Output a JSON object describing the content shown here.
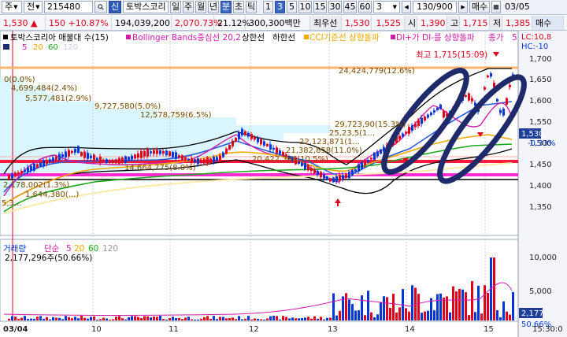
{
  "toolbar": {
    "type_select": "주",
    "market_select": "전",
    "code": "215480",
    "search_icon": "search-icon",
    "shin_badge": "신",
    "stock_name": "토박스코리",
    "period_buttons": [
      "일",
      "주",
      "월",
      "년",
      "분",
      "초",
      "틱"
    ],
    "active_period": "분",
    "interval_buttons": [
      "1",
      "3",
      "5",
      "10",
      "15",
      "30",
      "45",
      "60"
    ],
    "active_interval": "3",
    "interval_value": "3",
    "page_counter": "130/900",
    "buy_button": "매수",
    "date": "03/05"
  },
  "info": {
    "price": "1,530",
    "up_arrow": "▲",
    "change": "150",
    "change_pct": "+10.87%",
    "volume": "194,039,200",
    "volume_ratio": "2,070.73%",
    "turnover": "21.12%",
    "amount": "300,300백만",
    "best_label": "최우선",
    "ask": "1,530",
    "bid": "1,525",
    "open_label": "시",
    "open": "1,390",
    "high_label": "고",
    "high": "1,715",
    "low_label": "저",
    "low": "1,385",
    "ma_box": "매수"
  },
  "colors": {
    "up": "#e0001b",
    "down": "#0037d6",
    "ma5": "#d11aa8",
    "ma20": "#f0a800",
    "ma60": "#1aa81a",
    "ma120": "#d4c8ff",
    "bollinger": "#000000",
    "resist_magenta": "#ff2bd2",
    "resist_red": "#ff1a3c",
    "resist_orange": "#ffb46b",
    "ellipse": "#1f2a6b"
  },
  "price_panel": {
    "legend_items": [
      "토박스코리아 매물대 수(15)",
      "Bollinger Bands중심선 20,2",
      "상한선",
      "하한선",
      "CCI기준선 상향돌파",
      "DI+가 DI-를 상향돌파",
      "종가"
    ],
    "legend_last": "5",
    "ma_labels": [
      "5",
      "20",
      "60",
      "120"
    ],
    "high_note": "최고 1,715(15:09)",
    "volume_profile_labels": [
      "0(0.0%)",
      "4,699,484(2.4%)",
      "5,577,481(2.9%)",
      "9,727,580(5.0%)",
      "12,578,759(6.5%)",
      "24,424,779(12.6%)",
      "29,723,90(15.3%)",
      "25,23,5(1...",
      "22,123,871(1...",
      "21,382,858(11.0%)",
      "20,422,366(10.5%)",
      "14,664,775(8.0%)",
      "2,178,002(1.3%)",
      "1,644,380(...)",
      "5,3..."
    ],
    "price_axis": [
      "1,700",
      "1,650",
      "1,600",
      "1,550",
      "1,500",
      "1,450",
      "1,400",
      "1,350"
    ],
    "axis_top_labels": [
      "LC:10,8",
      "HC:-10"
    ],
    "current_price_tag": "1,530",
    "current_pct_tag": "-0.33%"
  },
  "volume_panel": {
    "legend_items": [
      "거래량",
      "단순",
      "5",
      "20",
      "60",
      "120"
    ],
    "volume_value": "2,177,296주(50.66%)",
    "axis": [
      "10,000",
      "5,000"
    ],
    "current_tag": "2,177",
    "pct_tag": "50.66%"
  },
  "x_axis": {
    "labels": [
      "03/04",
      "10",
      "11",
      "12",
      "13",
      "14",
      "15",
      "15:30:0"
    ]
  }
}
